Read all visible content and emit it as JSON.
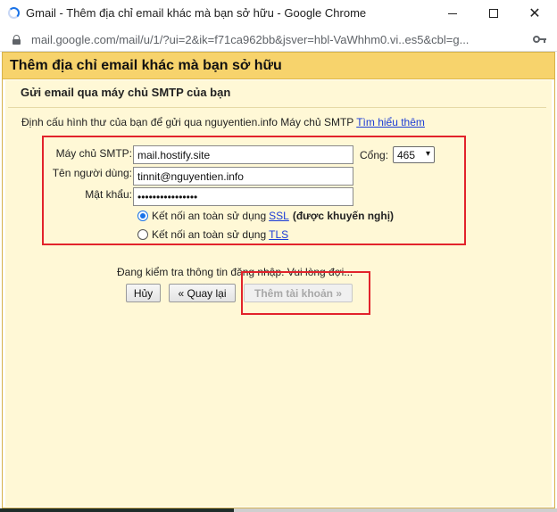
{
  "browser": {
    "window_title": "Gmail - Thêm địa chỉ email khác mà bạn sở hữu - Google Chrome",
    "url": "mail.google.com/mail/u/1/?ui=2&ik=f71ca962bb&jsver=hbl-VaWhhm0.vi..es5&cbl=g..."
  },
  "dialog": {
    "title": "Thêm địa chỉ email khác mà bạn sở hữu",
    "section_title": "Gửi email qua máy chủ SMTP của bạn",
    "description": "Định cấu hình thư của bạn để gửi qua nguyentien.info Máy chủ SMTP",
    "learn_more": "Tìm hiểu thêm",
    "smtp_label": "Máy chủ SMTP:",
    "smtp_value": "mail.hostify.site",
    "port_label": "Cổng:",
    "port_value": "465",
    "username_label": "Tên người dùng:",
    "username_value": "tinnit@nguyentien.info",
    "password_label": "Mật khẩu:",
    "password_value": "••••••••••••••••",
    "ssl_option_prefix": "Kết nối an toàn sử dụng",
    "ssl_link": "SSL",
    "ssl_note": "(được khuyến nghị)",
    "tls_option_prefix": "Kết nối an toàn sử dụng",
    "tls_link": "TLS",
    "status": "Đang kiểm tra thông tin đăng nhập. Vui lòng đợi...",
    "cancel_button": "Hủy",
    "back_button": "« Quay lại",
    "add_account_button": "Thêm tài khoản »"
  },
  "colors": {
    "header_bg": "#f7d36c",
    "body_bg": "#fff8d6",
    "highlight": "#e2232b",
    "link": "#1a3bd6"
  }
}
